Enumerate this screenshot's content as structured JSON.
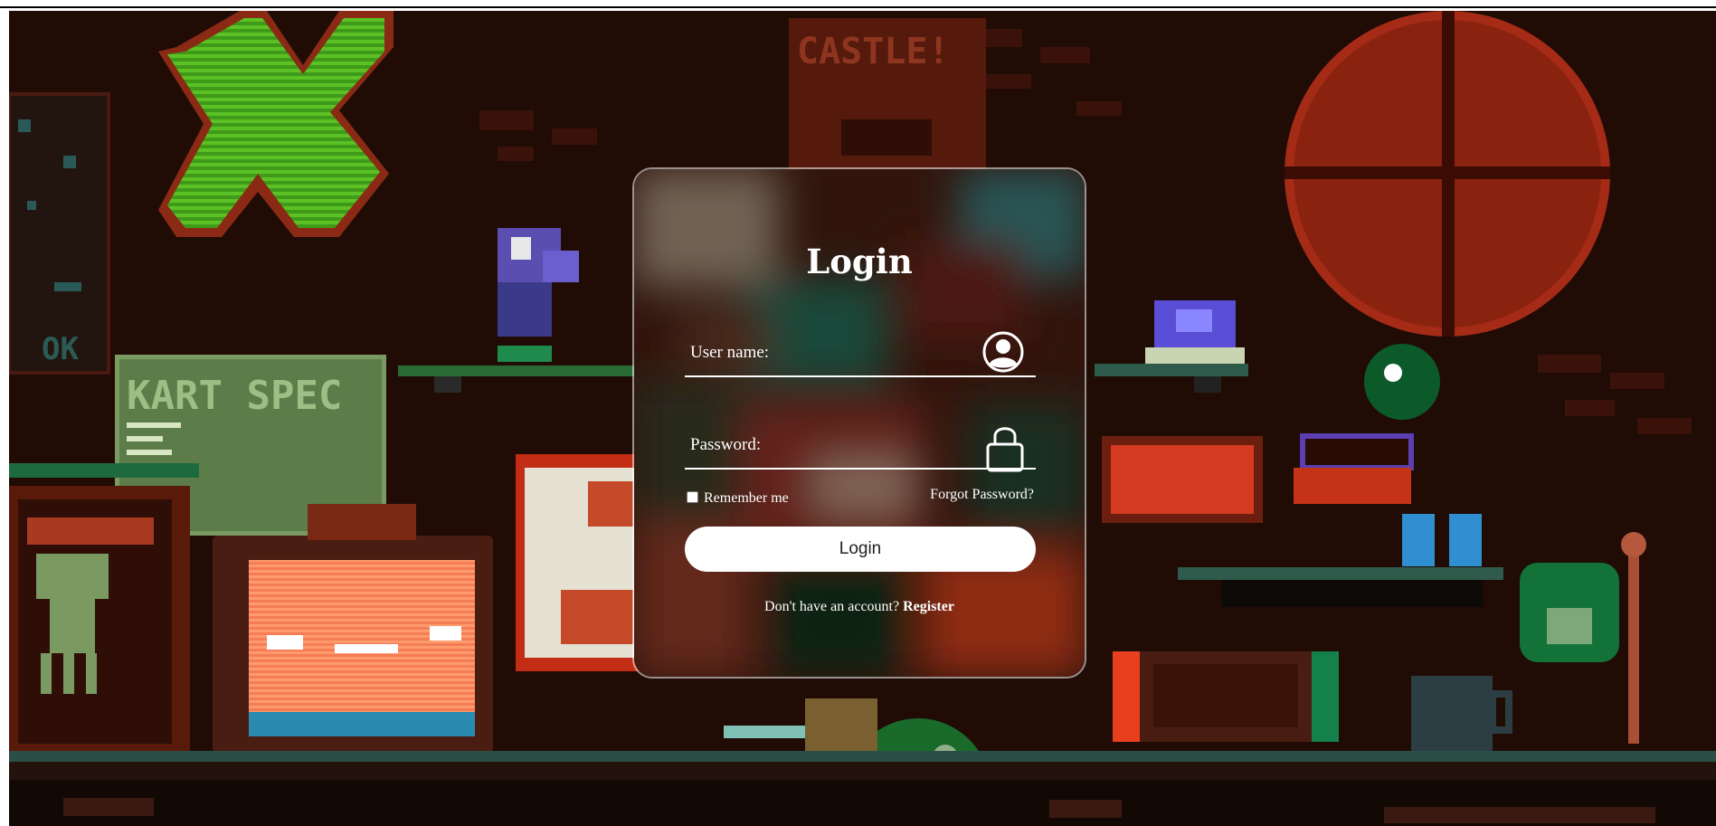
{
  "background": {
    "poster_castle_text": "CASTLE!",
    "poster_kart_text": "KART SPEC",
    "wall_sign_text": "OK",
    "colors": {
      "wall": "#1e0a05",
      "accent_red": "#b8311c",
      "accent_green": "#58b822",
      "shelf": "#2f5b4c"
    }
  },
  "login": {
    "title": "Login",
    "username_placeholder": "User name:",
    "password_placeholder": "Password:",
    "username_icon": "user-circle-icon",
    "password_icon": "lock-icon",
    "remember_label": "Remember me",
    "remember_checked": false,
    "forgot_label": "Forgot Password?",
    "button_label": "Login",
    "register_prompt": "Don't have an account?",
    "register_label": "Register"
  }
}
